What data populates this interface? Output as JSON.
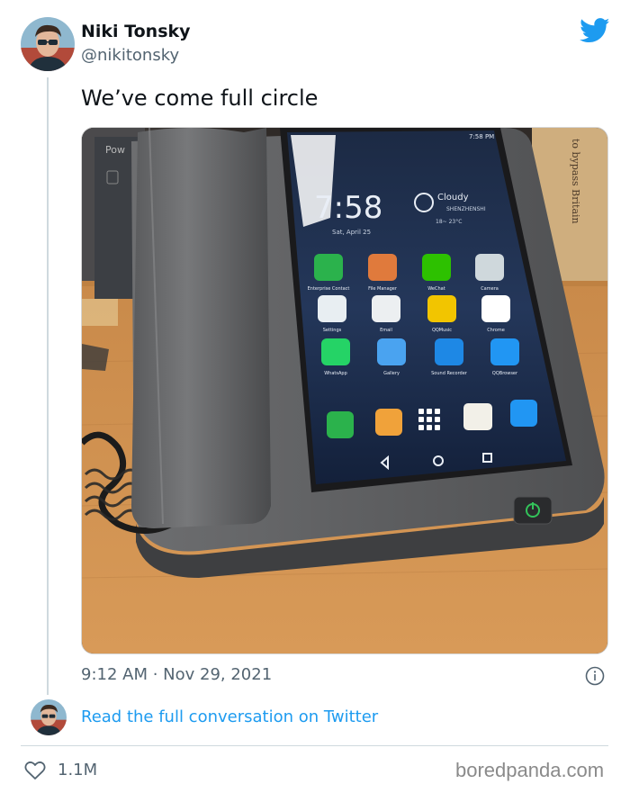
{
  "author": {
    "name": "Niki Tonsky",
    "handle": "@nikitonsky"
  },
  "tweet": {
    "text": "We’ve come full circle",
    "timestamp": "9:12 AM · Nov 29, 2021",
    "likes": "1.1M"
  },
  "links": {
    "read_full": "Read the full conversation on Twitter"
  },
  "watermark": "boredpanda.com",
  "phone_screen": {
    "status_time": "7:58 PM",
    "clock": "7:58",
    "weather": "Cloudy",
    "city": "SHENZHENSHI",
    "temp": "18~ 23°C",
    "date": "Sat, April 25",
    "apps": [
      {
        "label": "Enterprise Contact",
        "icon": "phone-app-icon",
        "color": "#2bb24c"
      },
      {
        "label": "File Manager",
        "icon": "folder-app-icon",
        "color": "#e07a3c"
      },
      {
        "label": "WeChat",
        "icon": "wechat-app-icon",
        "color": "#2dc100"
      },
      {
        "label": "Camera",
        "icon": "camera-app-icon",
        "color": "#cfd8dc"
      },
      {
        "label": "Settings",
        "icon": "settings-app-icon",
        "color": "#e8eef2"
      },
      {
        "label": "Email",
        "icon": "email-app-icon",
        "color": "#eceff1"
      },
      {
        "label": "QQMusic",
        "icon": "music-app-icon",
        "color": "#f2c500"
      },
      {
        "label": "Chrome",
        "icon": "chrome-app-icon",
        "color": "#ffffff"
      },
      {
        "label": "WhatsApp",
        "icon": "whatsapp-app-icon",
        "color": "#25d366"
      },
      {
        "label": "Gallery",
        "icon": "gallery-app-icon",
        "color": "#4aa3f0"
      },
      {
        "label": "Sound Recorder",
        "icon": "mic-app-icon",
        "color": "#1e88e5"
      },
      {
        "label": "QQBrowser",
        "icon": "browser-app-icon",
        "color": "#2196f3"
      }
    ],
    "booklet_text": "to bypass Britain",
    "box_text": "Pow"
  },
  "colors": {
    "twitter_blue": "#1d9bf0",
    "text_primary": "#0f1419",
    "text_secondary": "#536471"
  }
}
